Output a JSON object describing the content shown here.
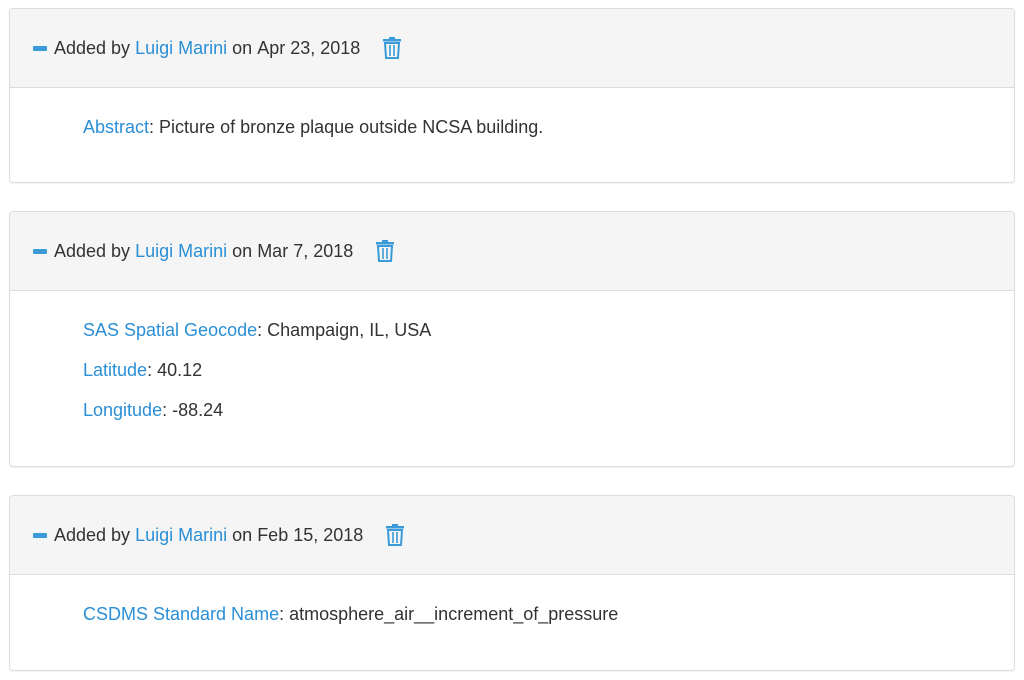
{
  "colors": {
    "link": "#2a8fd6",
    "icon": "#3b9bd8",
    "heading_bg": "#f5f5f5",
    "border": "#dddddd"
  },
  "entries": [
    {
      "added_by_label": "Added by",
      "author": "Luigi Marini",
      "on_label": "on",
      "date": "Apr 23, 2018",
      "fields": [
        {
          "key": "Abstract",
          "value": "Picture of bronze plaque outside NCSA building."
        }
      ]
    },
    {
      "added_by_label": "Added by",
      "author": "Luigi Marini",
      "on_label": "on",
      "date": "Mar 7, 2018",
      "fields": [
        {
          "key": "SAS Spatial Geocode",
          "value": "Champaign, IL, USA"
        },
        {
          "key": "Latitude",
          "value": "40.12"
        },
        {
          "key": "Longitude",
          "value": "-88.24"
        }
      ]
    },
    {
      "added_by_label": "Added by",
      "author": "Luigi Marini",
      "on_label": "on",
      "date": "Feb 15, 2018",
      "fields": [
        {
          "key": "CSDMS Standard Name",
          "value": "atmosphere_air__increment_of_pressure"
        }
      ]
    }
  ]
}
